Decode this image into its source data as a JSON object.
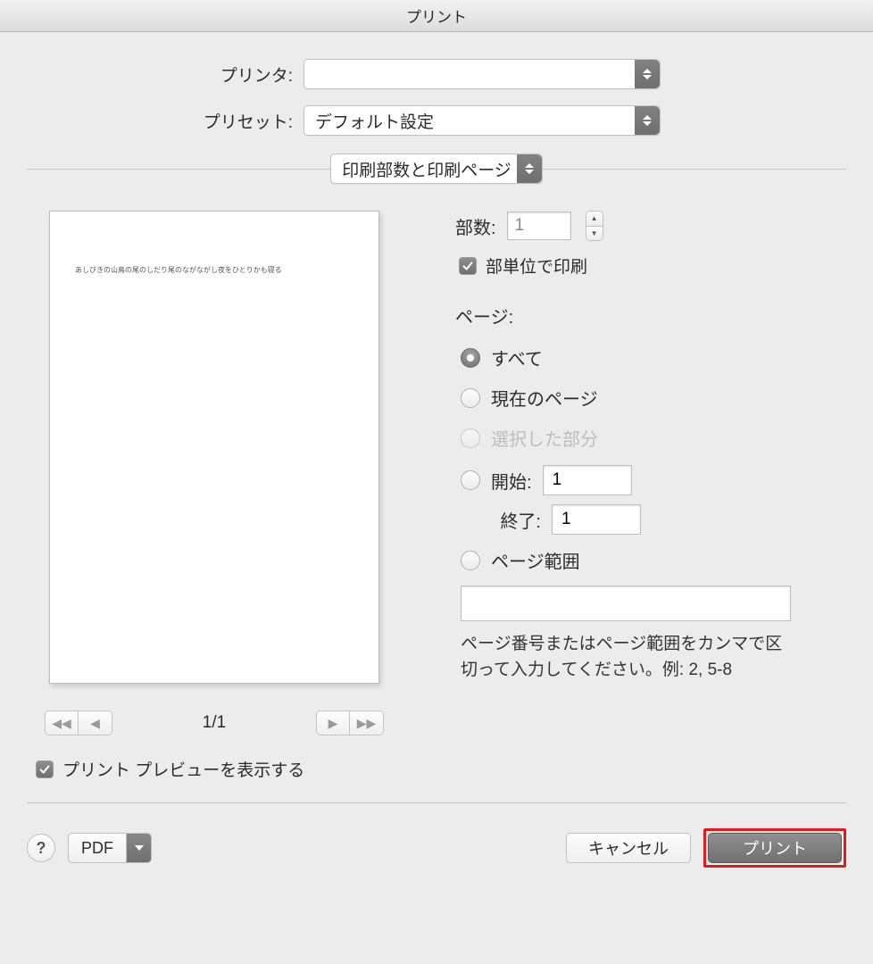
{
  "title": "プリント",
  "printer_label": "プリンタ:",
  "printer_value": "",
  "preset_label": "プリセット:",
  "preset_value": "デフォルト設定",
  "category_value": "印刷部数と印刷ページ",
  "copies": {
    "label": "部数:",
    "value": "1",
    "collate_label": "部単位で印刷"
  },
  "pages": {
    "label": "ページ:",
    "all": "すべて",
    "current": "現在のページ",
    "selection": "選択した部分",
    "from_label": "開始:",
    "from_value": "1",
    "to_label": "終了:",
    "to_value": "1",
    "range_label": "ページ範囲",
    "range_value": "",
    "hint": "ページ番号またはページ範囲をカンマで区切って入力してください。例: 2, 5-8"
  },
  "preview": {
    "page_indicator": "1/1",
    "show_label": "プリント プレビューを表示する",
    "sample_text": "あしびきの山鳥の尾のしだり尾のながながし夜をひとりかも寝る"
  },
  "footer": {
    "pdf": "PDF",
    "cancel": "キャンセル",
    "print": "プリント"
  }
}
